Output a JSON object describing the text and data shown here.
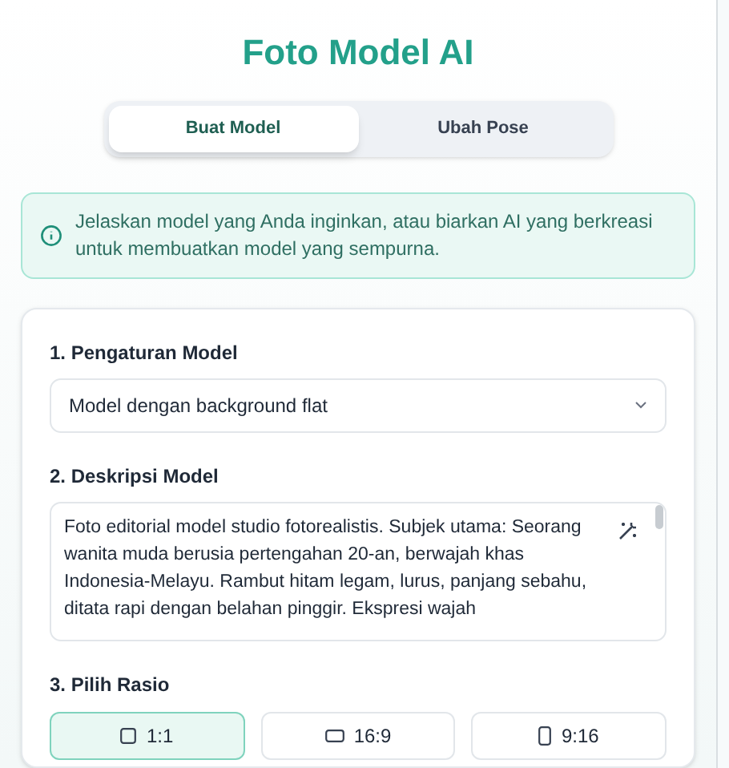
{
  "title": "Foto Model AI",
  "tabs": [
    {
      "label": "Buat Model",
      "selected": true
    },
    {
      "label": "Ubah Pose",
      "selected": false
    }
  ],
  "info": "Jelaskan model yang Anda inginkan, atau biarkan AI yang berkreasi untuk membuatkan model yang sempurna.",
  "sections": [
    {
      "label": "1. Pengaturan Model",
      "kind": "select",
      "value": "Model dengan background flat"
    },
    {
      "label": "2. Deskripsi Model",
      "kind": "textarea",
      "value": "Foto editorial model studio fotorealistis. Subjek utama: Seorang wanita muda berusia pertengahan 20-an, berwajah khas Indonesia-Melayu. Rambut hitam legam, lurus, panjang sebahu, ditata rapi dengan belahan pinggir. Ekspresi wajah"
    },
    {
      "label": "3. Pilih Rasio",
      "kind": "ratios",
      "options": [
        {
          "label": "1:1",
          "kind": "square",
          "selected": true
        },
        {
          "label": "16:9",
          "kind": "wide",
          "selected": false
        },
        {
          "label": "9:16",
          "kind": "tall",
          "selected": false
        }
      ]
    }
  ]
}
